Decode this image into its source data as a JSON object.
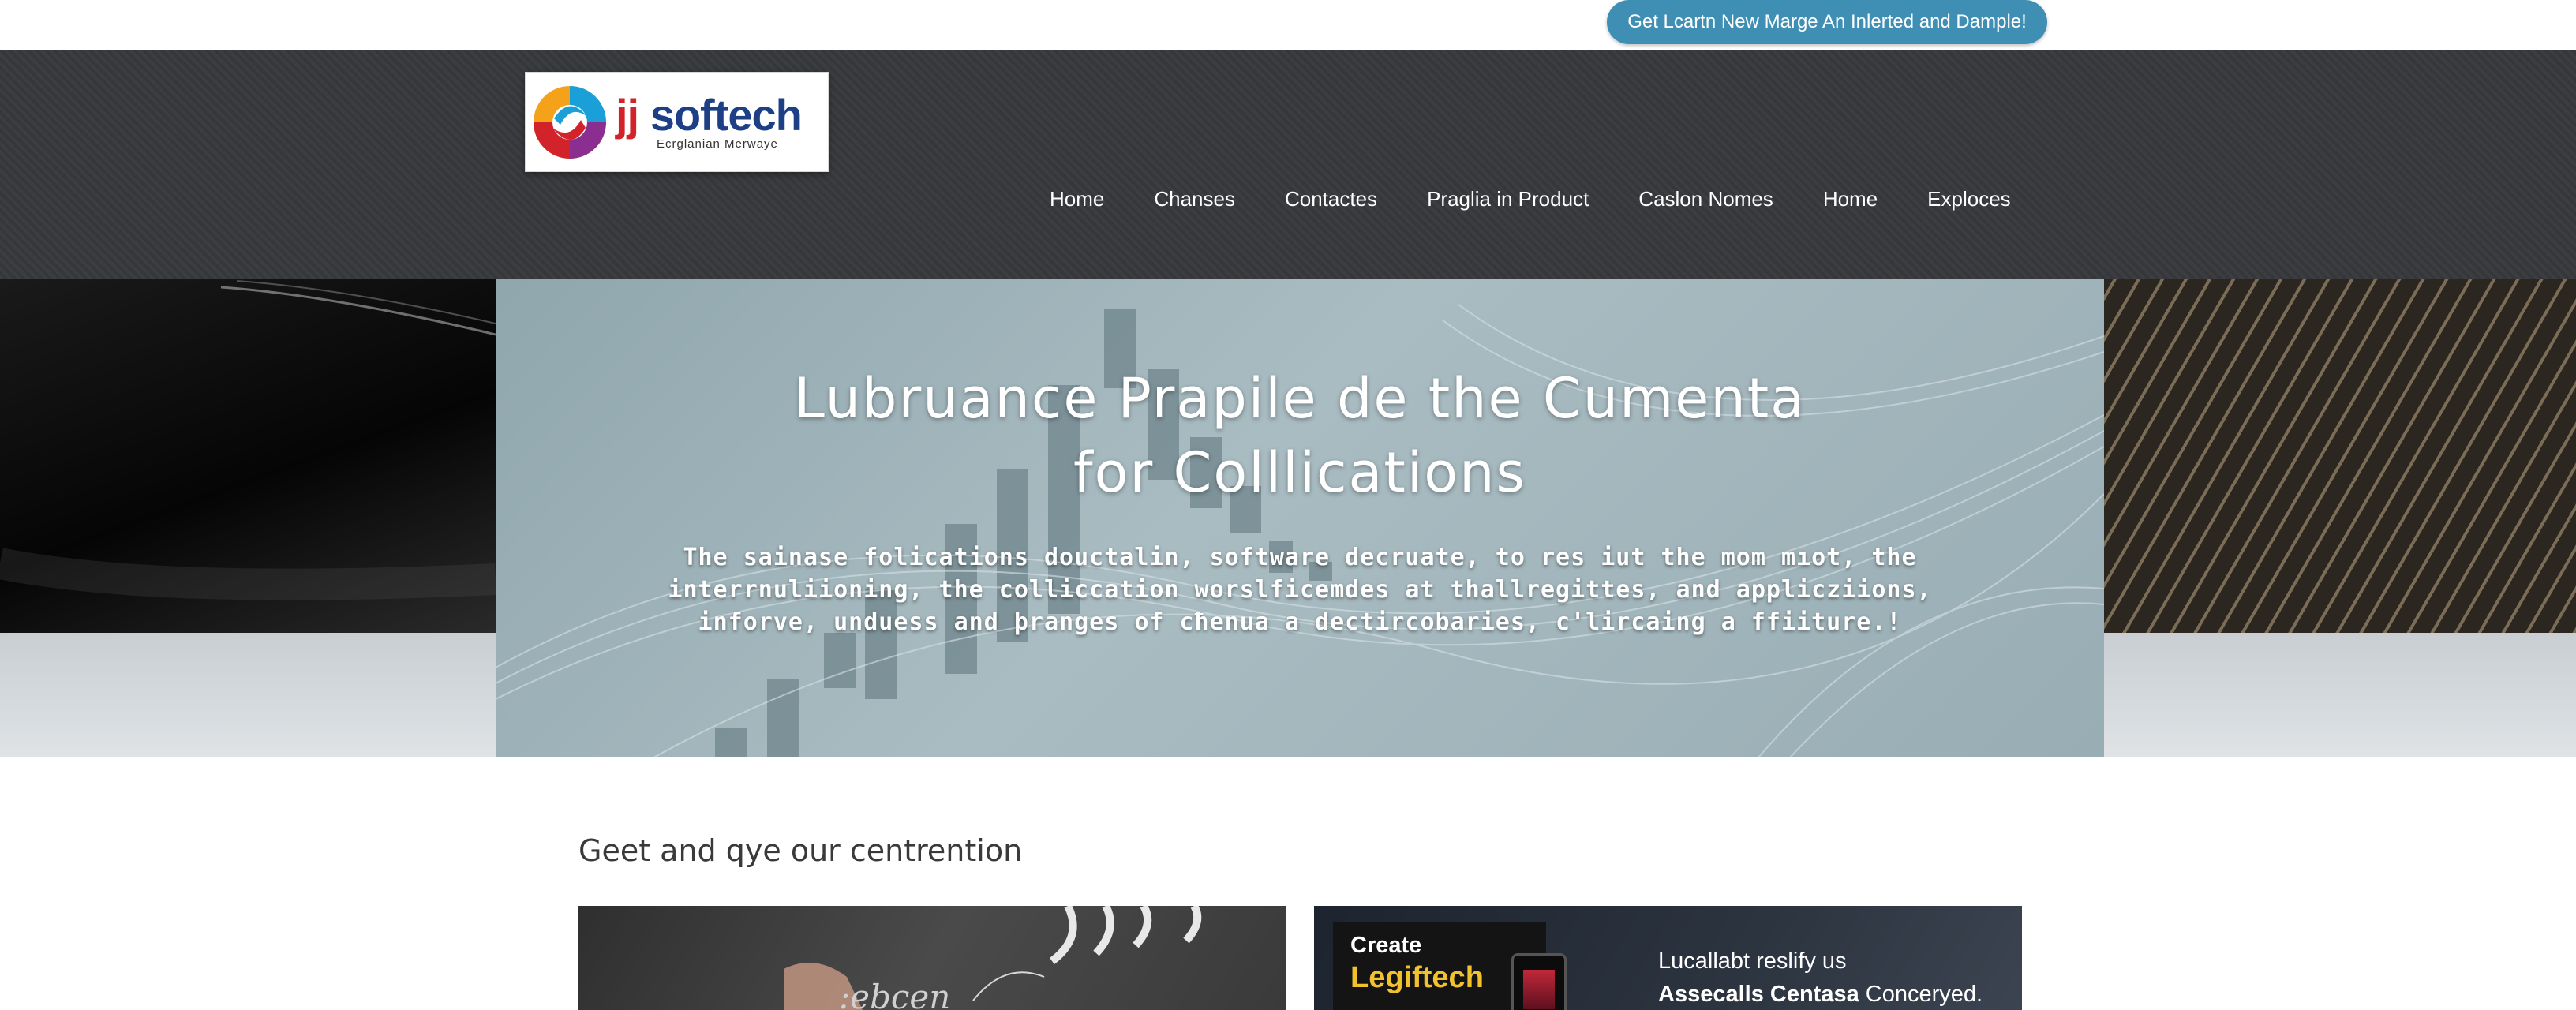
{
  "topbar": {
    "cta_label": "Get Lcartn New Marge An Inlerted and Dample!",
    "cta_color": "#3f8fb5"
  },
  "logo": {
    "name_prefix": "jj",
    "name_main": "softech",
    "tagline": "Ecrglanian Merwaye"
  },
  "nav": {
    "items": [
      {
        "label": "Home"
      },
      {
        "label": "Chanses"
      },
      {
        "label": "Contactes"
      },
      {
        "label": "Praglia in Product"
      },
      {
        "label": "Caslon Nomes"
      },
      {
        "label": "Home"
      },
      {
        "label": "Exploces"
      }
    ]
  },
  "hero": {
    "title_lines": [
      "Lubruance Prapile de the Cumenta",
      "for Colllications"
    ],
    "body_lines": [
      "The sainase folications doucta​lin, software decruate, to res iut the mom mıot, the",
      "interrnuliioning, the colliccation worslficemdes at thallregittes, and applicziions,",
      "inforve, unduess and þranges of cħenua a dectircobaries, c'lircaing a ffiiture.!"
    ]
  },
  "section": {
    "heading": "Geet and qye our centrention"
  },
  "cards": {
    "card2": {
      "create_label": "Create",
      "brand": "Legiftech",
      "line1": "Lucallabt reslify us",
      "line2_bold": "Assecalls Centasa",
      "line2_rest": " Conceryed."
    }
  },
  "colors": {
    "header_band": "#3b3d40",
    "brand_blue": "#1c3f86",
    "brand_red": "#d3232a",
    "card_accent": "#f2c12e"
  }
}
